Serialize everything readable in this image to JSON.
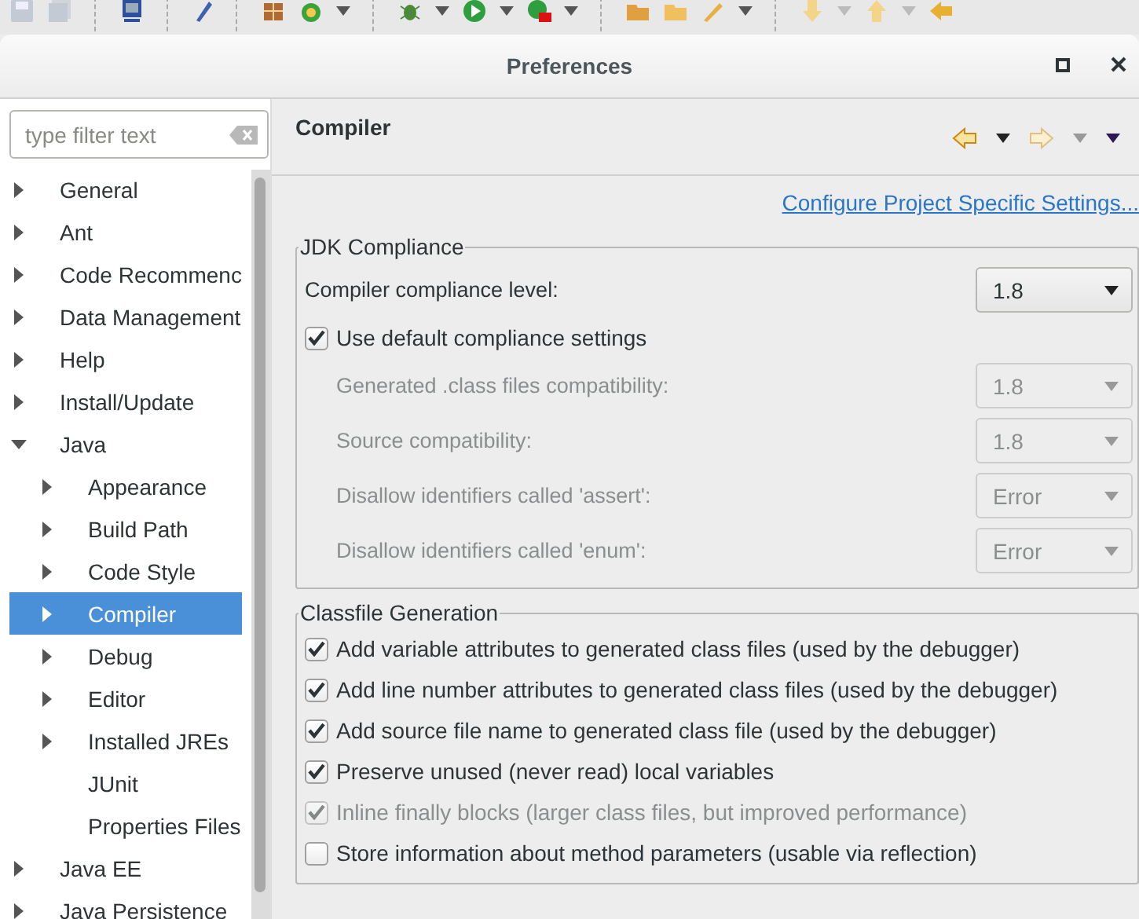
{
  "window": {
    "title": "Preferences"
  },
  "filter": {
    "placeholder": "type filter text"
  },
  "tree": [
    {
      "label": "General",
      "kind": "node",
      "expanded": false,
      "selected": false
    },
    {
      "label": "Ant",
      "kind": "node",
      "expanded": false,
      "selected": false
    },
    {
      "label": "Code Recommenc",
      "kind": "node",
      "expanded": false,
      "selected": false
    },
    {
      "label": "Data Management",
      "kind": "node",
      "expanded": false,
      "selected": false
    },
    {
      "label": "Help",
      "kind": "node",
      "expanded": false,
      "selected": false
    },
    {
      "label": "Install/Update",
      "kind": "node",
      "expanded": false,
      "selected": false
    },
    {
      "label": "Java",
      "kind": "node",
      "expanded": true,
      "selected": false,
      "children": [
        {
          "label": "Appearance",
          "kind": "node",
          "expanded": false,
          "selected": false
        },
        {
          "label": "Build Path",
          "kind": "node",
          "expanded": false,
          "selected": false
        },
        {
          "label": "Code Style",
          "kind": "node",
          "expanded": false,
          "selected": false
        },
        {
          "label": "Compiler",
          "kind": "node",
          "expanded": false,
          "selected": true
        },
        {
          "label": "Debug",
          "kind": "node",
          "expanded": false,
          "selected": false
        },
        {
          "label": "Editor",
          "kind": "node",
          "expanded": false,
          "selected": false
        },
        {
          "label": "Installed JREs",
          "kind": "node",
          "expanded": false,
          "selected": false
        },
        {
          "label": "JUnit",
          "kind": "leaf",
          "selected": false
        },
        {
          "label": "Properties Files",
          "kind": "leaf",
          "selected": false
        }
      ]
    },
    {
      "label": "Java EE",
      "kind": "node",
      "expanded": false,
      "selected": false
    },
    {
      "label": "Java Persistence",
      "kind": "node",
      "expanded": false,
      "selected": false
    }
  ],
  "page": {
    "title": "Compiler",
    "link": "Configure Project Specific Settings..."
  },
  "jdk_compliance": {
    "title": "JDK Compliance",
    "rows": [
      {
        "kind": "dropdown",
        "label": "Compiler compliance level:",
        "value": "1.8",
        "disabled": false
      },
      {
        "kind": "checkbox",
        "label": "Use default compliance settings",
        "checked": true,
        "disabled": false
      },
      {
        "kind": "dropdown",
        "label": "Generated .class files compatibility:",
        "value": "1.8",
        "disabled": true
      },
      {
        "kind": "dropdown",
        "label": "Source compatibility:",
        "value": "1.8",
        "disabled": true
      },
      {
        "kind": "dropdown",
        "label": "Disallow identifiers called 'assert':",
        "value": "Error",
        "disabled": true
      },
      {
        "kind": "dropdown",
        "label": "Disallow identifiers called 'enum':",
        "value": "Error",
        "disabled": true
      }
    ]
  },
  "classfile_generation": {
    "title": "Classfile Generation",
    "rows": [
      {
        "label": "Add variable attributes to generated class files (used by the debugger)",
        "checked": true,
        "disabled": false
      },
      {
        "label": "Add line number attributes to generated class files (used by the debugger)",
        "checked": true,
        "disabled": false
      },
      {
        "label": "Add source file name to generated class file (used by the debugger)",
        "checked": true,
        "disabled": false
      },
      {
        "label": "Preserve unused (never read) local variables",
        "checked": true,
        "disabled": false
      },
      {
        "label": "Inline finally blocks (larger class files, but improved performance)",
        "checked": true,
        "disabled": true
      },
      {
        "label": "Store information about method parameters (usable via reflection)",
        "checked": false,
        "disabled": false
      }
    ]
  }
}
